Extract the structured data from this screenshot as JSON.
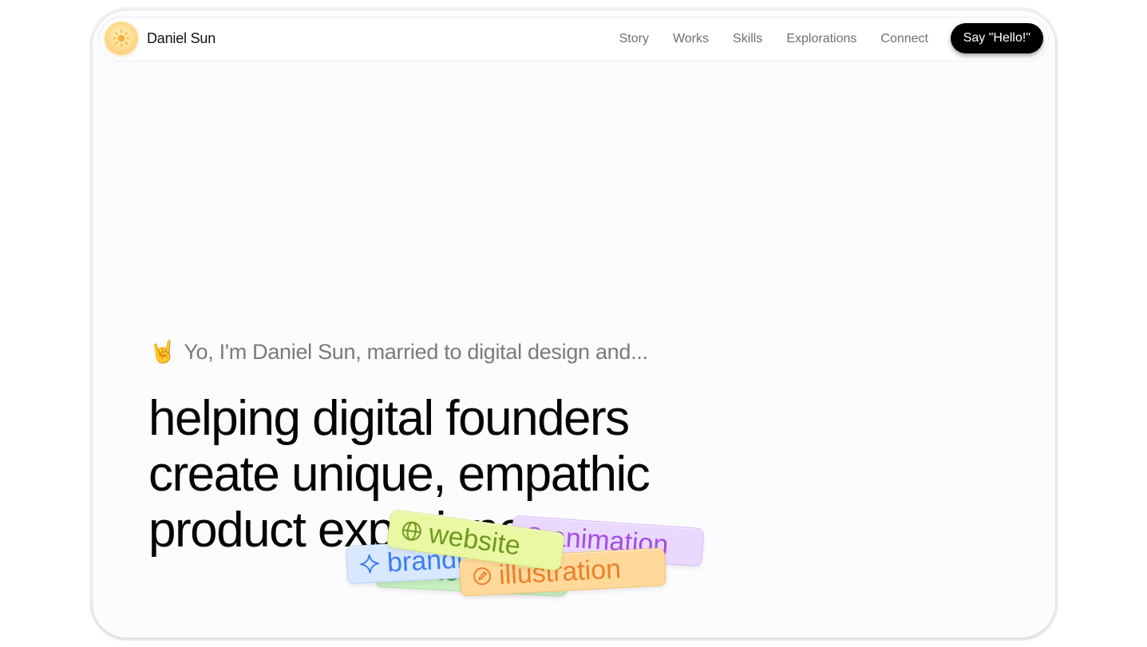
{
  "brand": {
    "name": "Daniel Sun",
    "logo_icon": "sun-icon"
  },
  "nav": {
    "items": [
      {
        "label": "Story"
      },
      {
        "label": "Works"
      },
      {
        "label": "Skills"
      },
      {
        "label": "Explorations"
      },
      {
        "label": "Connect"
      }
    ],
    "cta_label": "Say \"Hello!\""
  },
  "hero": {
    "intro_emoji": "🤘",
    "intro_text": "Yo, I'm Daniel Sun, married to digital design and...",
    "headline_lines": [
      "helping digital founders",
      "create unique, empathic",
      "product experiences"
    ]
  },
  "tags": {
    "interaction": {
      "label": "interaction",
      "icon": "chat-icon",
      "color": "#4aa35a"
    },
    "animation": {
      "label": "animation",
      "icon": "play-icon",
      "color": "#a24de3"
    },
    "branding": {
      "label": "branding",
      "icon": "sparkle-icon",
      "color": "#3a7ef0"
    },
    "illustration": {
      "label": "illustration",
      "icon": "pencil-icon",
      "color": "#ec7f2b"
    },
    "website": {
      "label": "website",
      "icon": "globe-icon",
      "color": "#6f9a1e"
    }
  },
  "colors": {
    "cta_background": "#000000",
    "page_background": "#fcfbfd",
    "nav_text": "#6f6f75"
  }
}
